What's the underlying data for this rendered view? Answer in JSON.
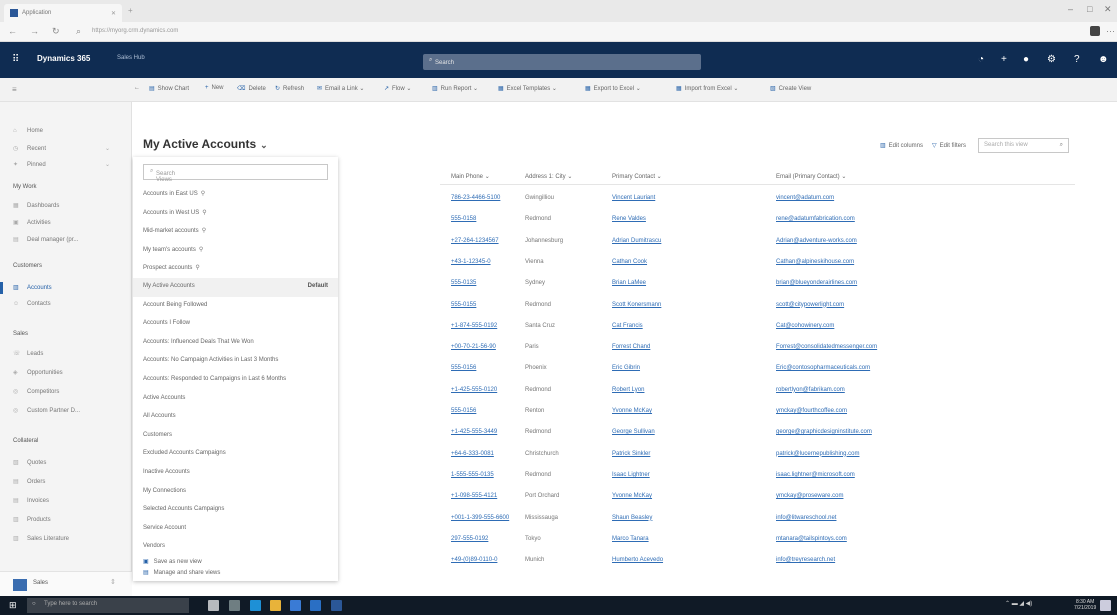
{
  "browser": {
    "tab_title": "Application",
    "url": "https://myorg.crm.dynamics.com"
  },
  "app": {
    "name": "Dynamics 365",
    "area": "Sales Hub",
    "search_placeholder": "Search"
  },
  "commands": [
    {
      "icon": "chart-icon",
      "label": "Show Chart"
    },
    {
      "icon": "plus-icon",
      "label": "New"
    },
    {
      "icon": "trash-icon",
      "label": "Delete"
    },
    {
      "icon": "refresh-icon",
      "label": "Refresh"
    },
    {
      "icon": "email-link-icon",
      "label": "Email a Link"
    },
    {
      "icon": "flow-icon",
      "label": "Flow"
    },
    {
      "icon": "report-icon",
      "label": "Run Report"
    },
    {
      "icon": "excel-icon",
      "label": "Excel Templates"
    },
    {
      "icon": "excel-export-icon",
      "label": "Export to Excel"
    },
    {
      "icon": "excel-import-icon",
      "label": "Import from Excel"
    },
    {
      "icon": "create-view-icon",
      "label": "Create View"
    }
  ],
  "sidebar": {
    "top_items": [
      {
        "icon": "home-icon",
        "label": "Home"
      },
      {
        "icon": "clock-icon",
        "label": "Recent"
      },
      {
        "icon": "pin-icon",
        "label": "Pinned"
      }
    ],
    "groups": [
      {
        "title": "My Work",
        "items": [
          {
            "icon": "dashboard-icon",
            "label": "Dashboards"
          },
          {
            "icon": "activities-icon",
            "label": "Activities"
          },
          {
            "icon": "deal-manager-icon",
            "label": "Deal manager (pr..."
          }
        ]
      },
      {
        "title": "Customers",
        "items": [
          {
            "icon": "accounts-icon",
            "label": "Accounts"
          },
          {
            "icon": "contacts-icon",
            "label": "Contacts"
          }
        ]
      },
      {
        "title": "Sales",
        "items": [
          {
            "icon": "leads-icon",
            "label": "Leads"
          },
          {
            "icon": "opportunities-icon",
            "label": "Opportunities"
          },
          {
            "icon": "competitors-icon",
            "label": "Competitors"
          },
          {
            "icon": "partner-icon",
            "label": "Custom Partner D..."
          }
        ]
      },
      {
        "title": "Collateral",
        "items": [
          {
            "icon": "quotes-icon",
            "label": "Quotes"
          },
          {
            "icon": "orders-icon",
            "label": "Orders"
          },
          {
            "icon": "invoices-icon",
            "label": "Invoices"
          },
          {
            "icon": "products-icon",
            "label": "Products"
          },
          {
            "icon": "literature-icon",
            "label": "Sales Literature"
          }
        ]
      }
    ],
    "area_switcher": {
      "badge": "SA",
      "label": "Sales"
    }
  },
  "view": {
    "title": "My Active Accounts",
    "search_placeholder": "Search Views",
    "default_label": "Default",
    "items": [
      {
        "label": "Accounts in East US",
        "pinned": true
      },
      {
        "label": "Accounts in West US",
        "pinned": true
      },
      {
        "label": "Mid-market accounts",
        "pinned": true
      },
      {
        "label": "My team's accounts",
        "pinned": true
      },
      {
        "label": "Prospect accounts",
        "pinned": true
      },
      {
        "label": "My Active Accounts",
        "selected": true
      },
      {
        "label": "Account Being Followed"
      },
      {
        "label": "Accounts I Follow"
      },
      {
        "label": "Accounts: Influenced Deals That We Won"
      },
      {
        "label": "Accounts: No Campaign Activities in Last 3 Months"
      },
      {
        "label": "Accounts: Responded to Campaigns in Last 6 Months"
      },
      {
        "label": "Active Accounts"
      },
      {
        "label": "All Accounts"
      },
      {
        "label": "Customers"
      },
      {
        "label": "Excluded Accounts Campaigns"
      },
      {
        "label": "Inactive Accounts"
      },
      {
        "label": "My Connections"
      },
      {
        "label": "Selected Accounts Campaigns"
      },
      {
        "label": "Service Account"
      },
      {
        "label": "Vendors"
      }
    ],
    "actions": [
      {
        "icon": "save-view-icon",
        "label": "Save as new view"
      },
      {
        "icon": "manage-views-icon",
        "label": "Manage and share views"
      }
    ]
  },
  "grid_tools": {
    "edit_columns": "Edit columns",
    "edit_filters": "Edit filters",
    "search_placeholder": "Search this view"
  },
  "grid": {
    "columns": [
      "Main Phone",
      "Address 1: City",
      "Primary Contact",
      "Email (Primary Contact)"
    ],
    "rows": [
      [
        "786-23-4466-5100",
        "Gwingilliou",
        "Vincent Lauriant",
        "vincent@adatum.com"
      ],
      [
        "555-0158",
        "Redmond",
        "Rene Valdes",
        "rene@adatumfabrication.com"
      ],
      [
        "+27-264-1234567",
        "Johannesburg",
        "Adrian Dumitrascu",
        "Adrian@adventure-works.com"
      ],
      [
        "+43-1-12345-0",
        "Vienna",
        "Cathan Cook",
        "Cathan@alpineskihouse.com"
      ],
      [
        "555-0135",
        "Sydney",
        "Brian LaMee",
        "brian@blueyonderairlines.com"
      ],
      [
        "555-0155",
        "Redmond",
        "Scott Konersmann",
        "scott@citypowerlight.com"
      ],
      [
        "+1-874-555-0192",
        "Santa Cruz",
        "Cat Francis",
        "Cat@cohowinery.com"
      ],
      [
        "+00-70-21-56-90",
        "Paris",
        "Forrest Chand",
        "Forrest@consolidatedmessenger.com"
      ],
      [
        "555-0156",
        "Phoenix",
        "Eric Gibrin",
        "Eric@contosopharmaceuticals.com"
      ],
      [
        "+1-425-555-0120",
        "Redmond",
        "Robert Lyon",
        "robertlyon@fabrikam.com"
      ],
      [
        "555-0156",
        "Renton",
        "Yvonne McKay",
        "ymckay@fourthcoffee.com"
      ],
      [
        "+1-425-555-3449",
        "Redmond",
        "George Sullivan",
        "george@graphicdesigninstitute.com"
      ],
      [
        "+64-6-333-0081",
        "Christchurch",
        "Patrick Sinkler",
        "patrick@lucernepublishing.com"
      ],
      [
        "1-555-555-0135",
        "Redmond",
        "Isaac Lightner",
        "isaac.lightner@microsoft.com"
      ],
      [
        "+1-098-555-4121",
        "Port Orchard",
        "Yvonne McKay",
        "ymckay@proseware.com"
      ],
      [
        "+001-1-399-555-6600",
        "Mississauga",
        "Shaun Beasley",
        "info@litwareschool.net"
      ],
      [
        "297-555-0192",
        "Tokyo",
        "Marco Tanara",
        "mtanara@tailspintoys.com"
      ],
      [
        "+49-(0)89-0110-0",
        "Munich",
        "Humberto Acevedo",
        "info@treyresearch.net"
      ]
    ]
  },
  "taskbar": {
    "search_placeholder": "Type here to search",
    "time": "8:30 AM",
    "date": "7/21/2019"
  },
  "colors": {
    "app_bar": "#0f2c52",
    "accent": "#2561a8",
    "link": "#2e6cb5",
    "taskbar": "#101a26"
  }
}
